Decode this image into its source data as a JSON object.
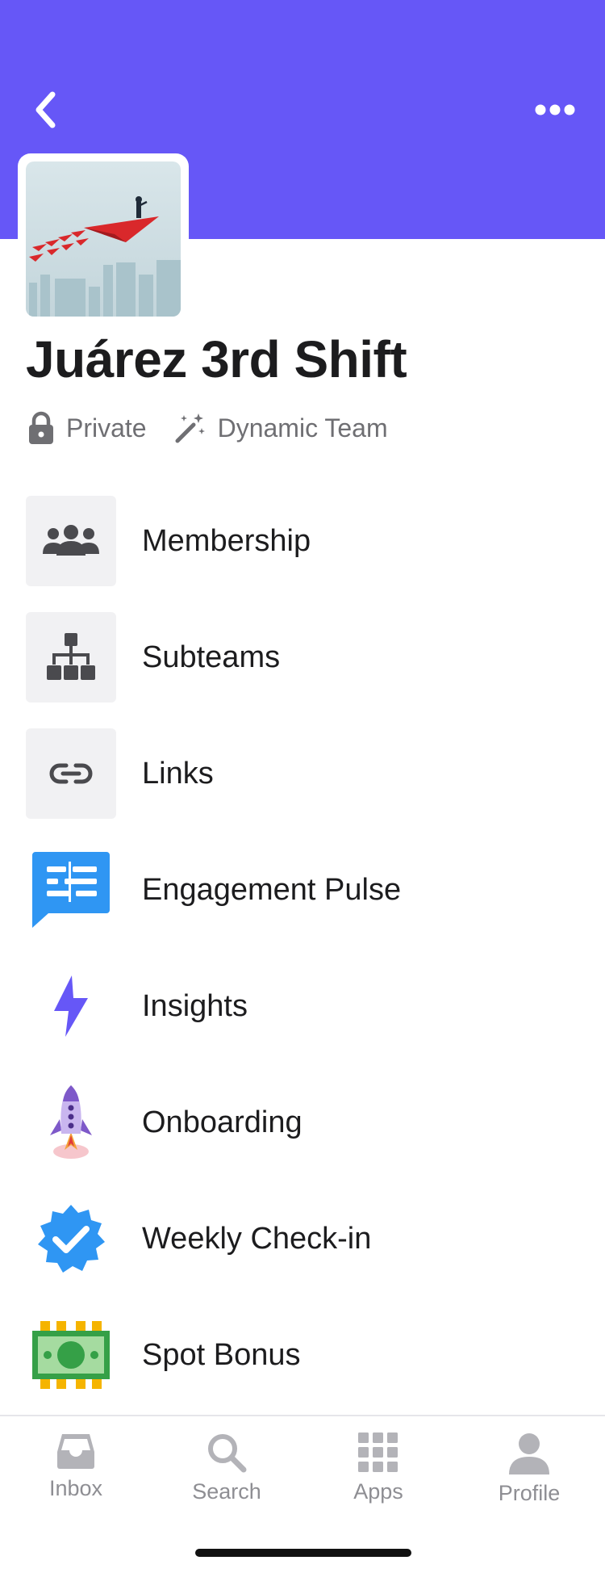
{
  "header": {
    "background_color": "#6657f7",
    "back_icon": "chevron-left-icon",
    "more_icon": "ellipsis-icon"
  },
  "team": {
    "name": "Juárez 3rd Shift",
    "privacy": "Private",
    "type": "Dynamic Team"
  },
  "menu": {
    "items": [
      {
        "label": "Membership",
        "icon": "people-icon"
      },
      {
        "label": "Subteams",
        "icon": "org-chart-icon"
      },
      {
        "label": "Links",
        "icon": "link-icon"
      },
      {
        "label": "Engagement Pulse",
        "icon": "engagement-pulse-icon"
      },
      {
        "label": "Insights",
        "icon": "lightning-icon"
      },
      {
        "label": "Onboarding",
        "icon": "rocket-icon"
      },
      {
        "label": "Weekly Check-in",
        "icon": "verified-badge-icon"
      },
      {
        "label": "Spot Bonus",
        "icon": "money-bill-icon"
      }
    ]
  },
  "tabbar": {
    "tabs": [
      {
        "label": "Inbox",
        "icon": "inbox-icon"
      },
      {
        "label": "Search",
        "icon": "search-icon"
      },
      {
        "label": "Apps",
        "icon": "apps-grid-icon"
      },
      {
        "label": "Profile",
        "icon": "person-icon"
      }
    ]
  },
  "colors": {
    "accent": "#6657f7",
    "text_primary": "#1c1c1e",
    "text_secondary": "#6f6f73",
    "tab_inactive": "#8e8e93"
  }
}
